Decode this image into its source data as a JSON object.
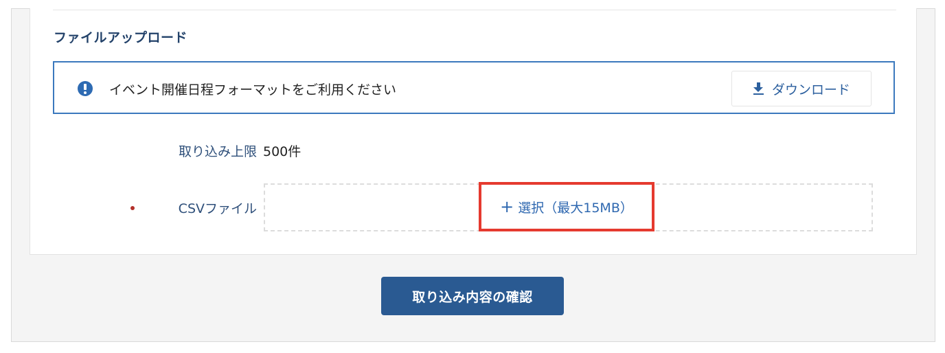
{
  "section": {
    "title": "ファイルアップロード"
  },
  "notice": {
    "text": "イベント開催日程フォーマットをご利用ください",
    "download_label": "ダウンロード"
  },
  "form": {
    "limit_label": "取り込み上限",
    "limit_value": "500件",
    "csv_label": "CSVファイル",
    "select_plus": "+",
    "select_label": "選択（最大15MB）"
  },
  "actions": {
    "confirm_label": "取り込み内容の確認"
  },
  "colors": {
    "accent": "#2a5a92",
    "highlight_border": "#e53a2f",
    "required": "#b3302a"
  }
}
